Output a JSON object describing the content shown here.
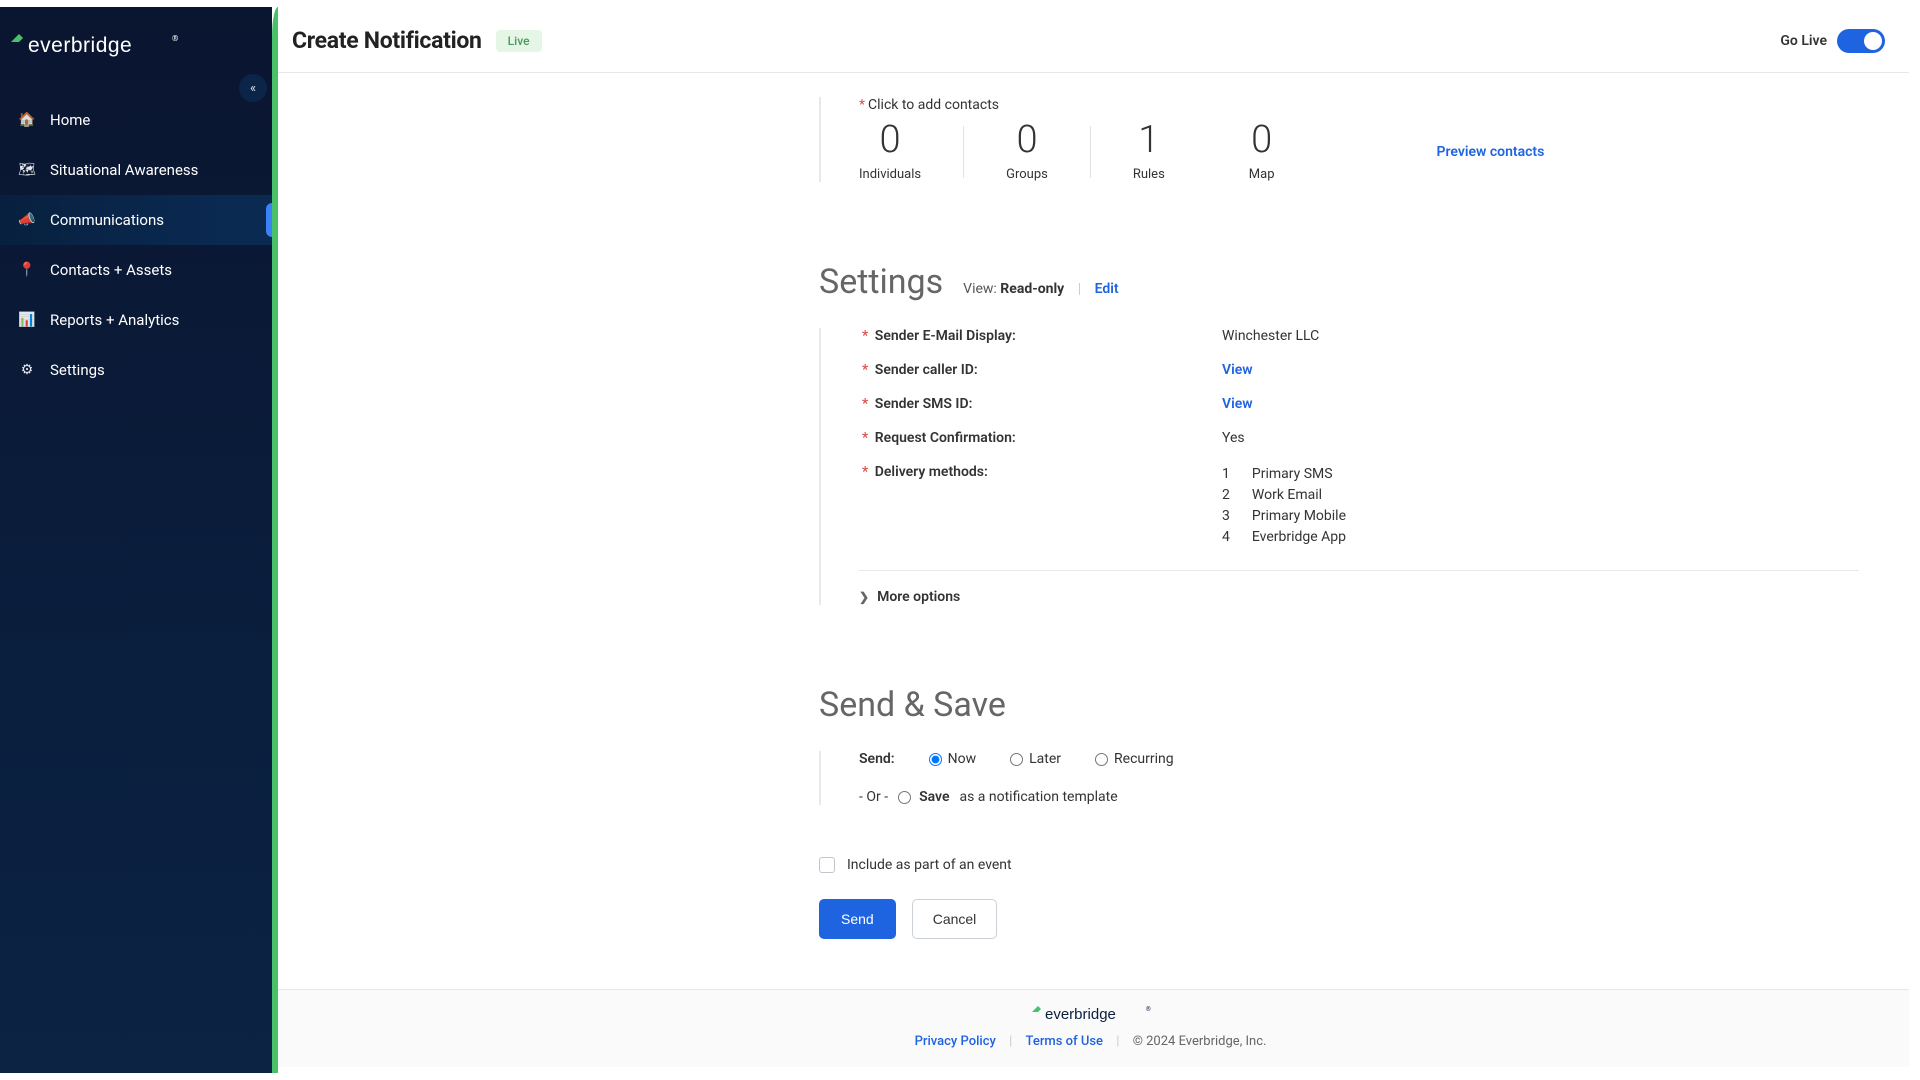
{
  "brand": "everbridge",
  "sidebar": {
    "items": [
      {
        "label": "Home"
      },
      {
        "label": "Situational Awareness"
      },
      {
        "label": "Communications"
      },
      {
        "label": "Contacts + Assets"
      },
      {
        "label": "Reports + Analytics"
      },
      {
        "label": "Settings"
      }
    ]
  },
  "header": {
    "title": "Create Notification",
    "badge": "Live",
    "go_live_label": "Go Live"
  },
  "contacts": {
    "hint": "Click to add contacts",
    "stats": [
      {
        "value": "0",
        "label": "Individuals"
      },
      {
        "value": "0",
        "label": "Groups"
      },
      {
        "value": "1",
        "label": "Rules"
      },
      {
        "value": "0",
        "label": "Map"
      }
    ],
    "preview": "Preview contacts"
  },
  "settings": {
    "title": "Settings",
    "view_label": "View:",
    "view_value": "Read-only",
    "edit": "Edit",
    "rows": {
      "email_display_label": "Sender E-Mail Display:",
      "email_display_value": "Winchester LLC",
      "caller_id_label": "Sender caller ID:",
      "caller_id_link": "View",
      "sms_id_label": "Sender SMS ID:",
      "sms_id_link": "View",
      "confirm_label": "Request Confirmation:",
      "confirm_value": "Yes",
      "delivery_label": "Delivery methods:",
      "delivery": [
        {
          "n": "1",
          "name": "Primary SMS"
        },
        {
          "n": "2",
          "name": "Work Email"
        },
        {
          "n": "3",
          "name": "Primary Mobile"
        },
        {
          "n": "4",
          "name": "Everbridge App"
        }
      ]
    },
    "more": "More options"
  },
  "sendsave": {
    "title": "Send & Save",
    "send_label": "Send:",
    "opts": {
      "now": "Now",
      "later": "Later",
      "recurring": "Recurring"
    },
    "or": "- Or -",
    "save": "Save",
    "save_suffix": "as a notification template",
    "event_label": "Include as part of an event"
  },
  "actions": {
    "send": "Send",
    "cancel": "Cancel"
  },
  "footer": {
    "privacy": "Privacy Policy",
    "terms": "Terms of Use",
    "copy": "© 2024 Everbridge, Inc."
  }
}
